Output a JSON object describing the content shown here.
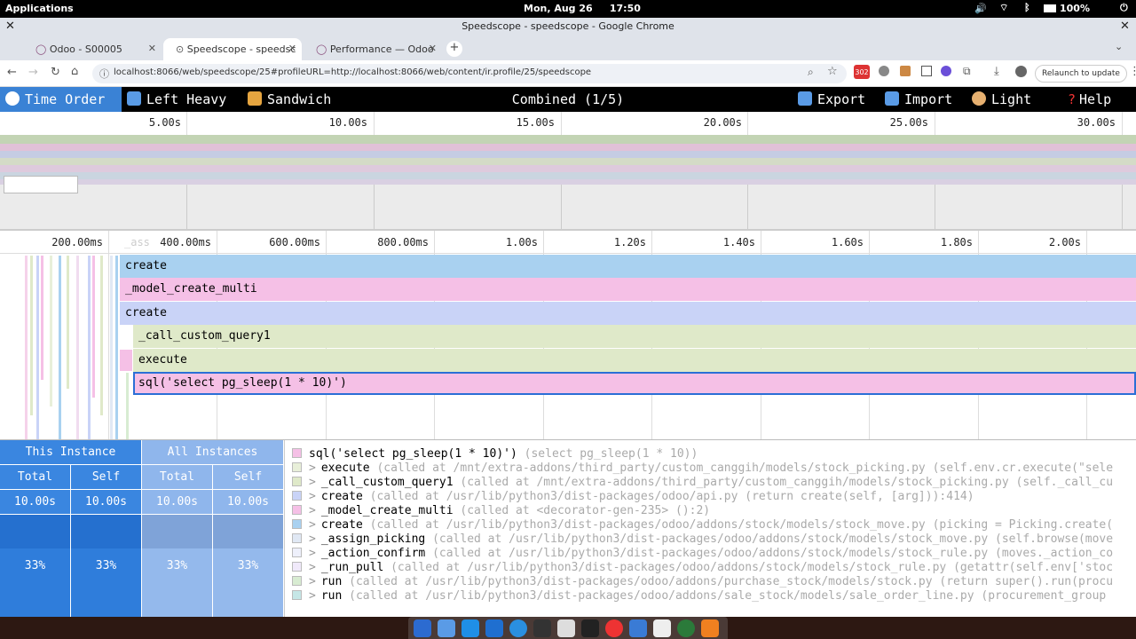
{
  "os": {
    "applications": "Applications",
    "clock": "Mon, Aug 26",
    "time": "17:50",
    "battery": "100%"
  },
  "window": {
    "title": "Speedscope - speedscope - Google Chrome"
  },
  "tabs": [
    {
      "label": "Odoo - S00005"
    },
    {
      "label": "Speedscope - speedsc"
    },
    {
      "label": "Performance — Odoo"
    }
  ],
  "address": {
    "url": "localhost:8066/web/speedscope/25#profileURL=http://localhost:8066/web/content/ir.profile/25/speedscope",
    "relaunch": "Relaunch to update",
    "badge": "302"
  },
  "toolbar": {
    "time_order": "Time Order",
    "left_heavy": "Left Heavy",
    "sandwich": "Sandwich",
    "combined": "Combined (1/5)",
    "export": "Export",
    "import": "Import",
    "light": "Light",
    "help": "Help"
  },
  "minimap": {
    "ticks": [
      "5.00s",
      "10.00s",
      "15.00s",
      "20.00s",
      "25.00s",
      "30.00s"
    ]
  },
  "flame": {
    "ticks": [
      "200.00ms",
      "400.00ms",
      "600.00ms",
      "800.00ms",
      "1.00s",
      "1.20s",
      "1.40s",
      "1.60s",
      "1.80s",
      "2.00s"
    ],
    "ghost_label": "_ass",
    "frames": [
      {
        "label": "create",
        "color": "#a9d1f0"
      },
      {
        "label": "_model_create_multi",
        "color": "#f5c0e6"
      },
      {
        "label": "create",
        "color": "#c9d3f7"
      },
      {
        "label": "_call_custom_query1",
        "color": "#dfe9c9"
      },
      {
        "label": "execute",
        "color": "#dfe9c9"
      },
      {
        "label": "sql('select pg_sleep(1 * 10)')",
        "color": "#f5c0e6"
      }
    ]
  },
  "stats": {
    "this_instance": "This Instance",
    "all_instances": "All Instances",
    "total": "Total",
    "self": "Self",
    "this_total": "10.00s",
    "this_self": "10.00s",
    "all_total": "10.00s",
    "all_self": "10.00s",
    "this_total_pct": "33%",
    "this_self_pct": "33%",
    "all_total_pct": "33%",
    "all_self_pct": "33%"
  },
  "stack": [
    {
      "name": "sql('select pg_sleep(1 * 10)')",
      "meta": "(select pg_sleep(1 * 10))",
      "color": "#f5c0e6",
      "arrow": ""
    },
    {
      "name": "execute",
      "meta": "(called at /mnt/extra-addons/third_party/custom_canggih/models/stock_picking.py (self.env.cr.execute(\"sele",
      "color": "#e8efd9",
      "arrow": ">"
    },
    {
      "name": "_call_custom_query1",
      "meta": "(called at /mnt/extra-addons/third_party/custom_canggih/models/stock_picking.py (self._call_cu",
      "color": "#dfe9c9",
      "arrow": ">"
    },
    {
      "name": "create",
      "meta": "(called at /usr/lib/python3/dist-packages/odoo/api.py (return create(self, [arg])):414)",
      "color": "#c9d3f7",
      "arrow": ">"
    },
    {
      "name": "_model_create_multi",
      "meta": "(called at <decorator-gen-235> ():2)",
      "color": "#f5c0e6",
      "arrow": ">"
    },
    {
      "name": "create",
      "meta": "(called at /usr/lib/python3/dist-packages/odoo/addons/stock/models/stock_move.py (picking = Picking.create(",
      "color": "#a9d1f0",
      "arrow": ">"
    },
    {
      "name": "_assign_picking",
      "meta": "(called at /usr/lib/python3/dist-packages/odoo/addons/stock/models/stock_move.py (self.browse(move",
      "color": "#e0e8f4",
      "arrow": ">"
    },
    {
      "name": "_action_confirm",
      "meta": "(called at /usr/lib/python3/dist-packages/odoo/addons/stock/models/stock_rule.py (moves._action_co",
      "color": "#eef0fb",
      "arrow": ">"
    },
    {
      "name": "_run_pull",
      "meta": "(called at /usr/lib/python3/dist-packages/odoo/addons/stock/models/stock_rule.py (getattr(self.env['stoc",
      "color": "#f0e9fa",
      "arrow": ">"
    },
    {
      "name": "run",
      "meta": "(called at /usr/lib/python3/dist-packages/odoo/addons/purchase_stock/models/stock.py (return super().run(procu",
      "color": "#d8ecd2",
      "arrow": ">"
    },
    {
      "name": "run",
      "meta": "(called at /usr/lib/python3/dist-packages/odoo/addons/sale_stock/models/sale_order_line.py (procurement_group",
      "color": "#c5e6e6",
      "arrow": ">"
    }
  ]
}
